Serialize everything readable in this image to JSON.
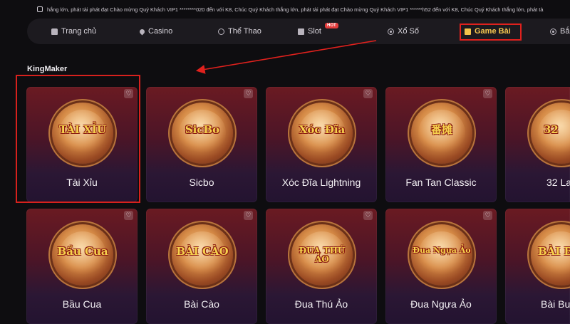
{
  "marquee": {
    "text": "hắng lớn, phát tài phát đạt Chào mừng Quý Khách VIP1 ********020 đến với K8, Chúc Quý Khách thắng lớn, phát tài phát đạt Chào mừng Quý Khách VIP1 ******h52 đến với K8, Chúc Quý Khách thắng lớn, phát tà"
  },
  "nav": {
    "items": [
      {
        "label": "Trang chủ",
        "icon": "home-icon"
      },
      {
        "label": "Casino",
        "icon": "spade-icon"
      },
      {
        "label": "Thể Thao",
        "icon": "soccer-ball-icon"
      },
      {
        "label": "Slot",
        "icon": "slot-machine-icon",
        "badge": "HOT"
      },
      {
        "label": "Xổ Số",
        "icon": "lottery-icon"
      },
      {
        "label": "Game Bài",
        "icon": "cards-icon",
        "active": true
      },
      {
        "label": "Bắ",
        "icon": "fish-icon"
      }
    ],
    "active_color": "#f6c750"
  },
  "section": {
    "title": "KingMaker"
  },
  "games": [
    {
      "title": "Tài Xỉu",
      "logo": "TÀI XỈU"
    },
    {
      "title": "Sicbo",
      "logo": "SicBo"
    },
    {
      "title": "Xóc Đĩa Lightning",
      "logo": "Xóc Đĩa"
    },
    {
      "title": "Fan Tan Classic",
      "logo": "番摊"
    },
    {
      "title": "32 La",
      "logo": "32"
    },
    {
      "title": "Bầu Cua",
      "logo": "Bầu Cua"
    },
    {
      "title": "Bài Cào",
      "logo": "BÀI CÀO"
    },
    {
      "title": "Đua Thú Ảo",
      "logo": "ĐUA THÚ ẢO"
    },
    {
      "title": "Đua Ngựa Ảo",
      "logo": "Đua Ngựa Ảo"
    },
    {
      "title": "Bài Bu",
      "logo": "BÀI BU"
    }
  ],
  "colors": {
    "background": "#0e0d10",
    "highlight_red": "#e0211d",
    "card_top": "#6a1a22",
    "card_bottom": "#231330"
  }
}
